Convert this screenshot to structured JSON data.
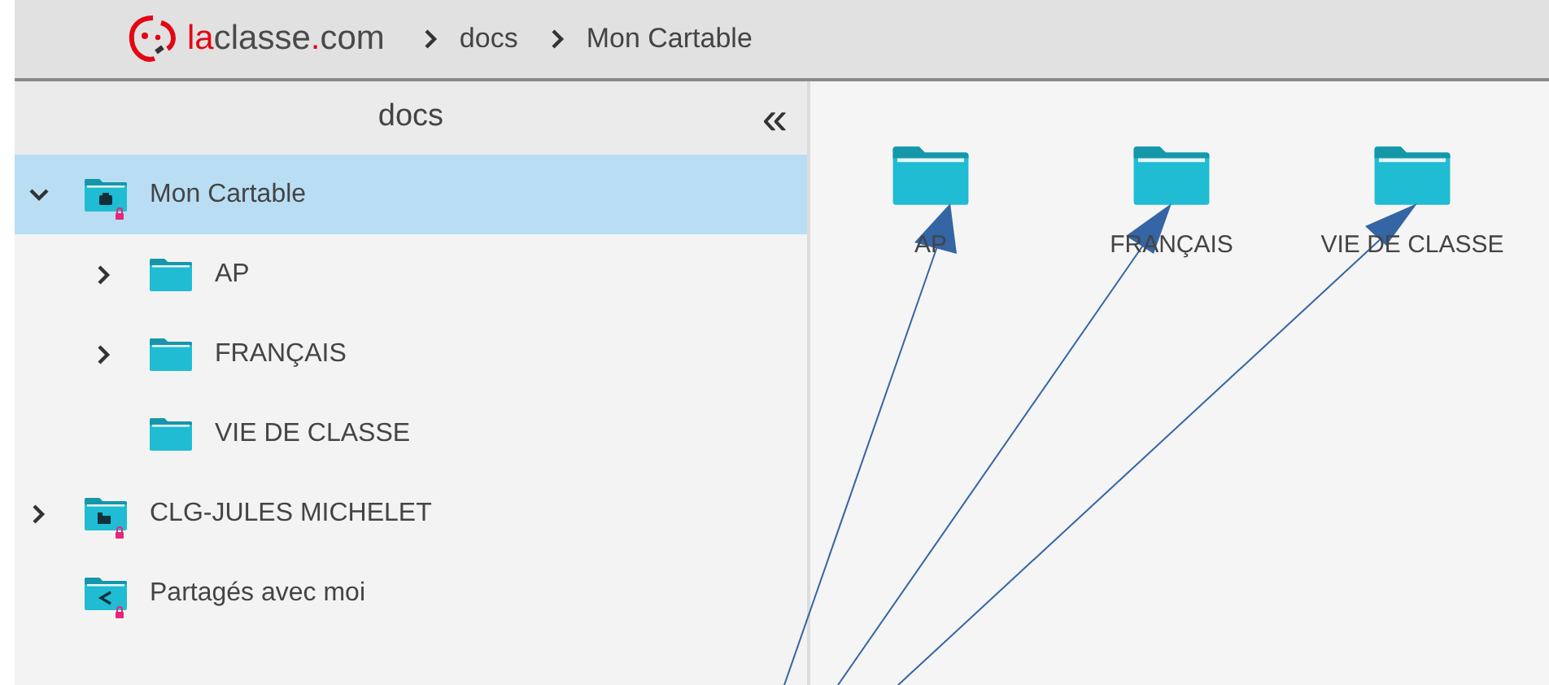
{
  "header": {
    "logo": [
      {
        "text": "la",
        "color": "#e30613"
      },
      {
        "text": "classe",
        "color": "#4a4a4a"
      },
      {
        "text": ".",
        "color": "#e30613"
      },
      {
        "text": "com",
        "color": "#4a4a4a"
      }
    ],
    "breadcrumb": [
      "docs",
      "Mon Cartable"
    ]
  },
  "sidebar": {
    "title": "docs",
    "collapse": "«",
    "tree": [
      {
        "label": "Mon Cartable",
        "kind": "bag",
        "locked": true,
        "selected": true,
        "expanded": true,
        "children": [
          {
            "label": "AP",
            "kind": "plain",
            "locked": false,
            "selected": false,
            "expanded": false,
            "has_children": true
          },
          {
            "label": "FRANÇAIS",
            "kind": "plain",
            "locked": false,
            "selected": false,
            "expanded": false,
            "has_children": true
          },
          {
            "label": "VIE DE CLASSE",
            "kind": "plain",
            "locked": false,
            "selected": false,
            "expanded": false,
            "has_children": false
          }
        ]
      },
      {
        "label": "CLG-JULES MICHELET",
        "kind": "building",
        "locked": true,
        "selected": false,
        "expanded": false,
        "has_children": true
      },
      {
        "label": "Partagés avec moi",
        "kind": "share",
        "locked": true,
        "selected": false,
        "expanded": false,
        "has_children": false
      }
    ]
  },
  "content": {
    "folders": [
      {
        "label": "AP"
      },
      {
        "label": "FRANÇAIS"
      },
      {
        "label": "VIE DE CLASSE"
      }
    ]
  }
}
